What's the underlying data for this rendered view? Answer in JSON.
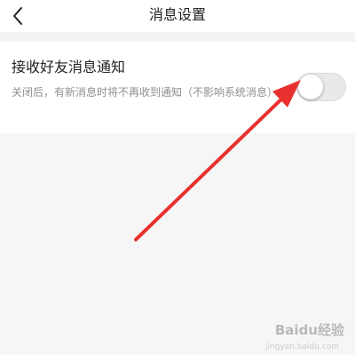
{
  "header": {
    "title": "消息设置",
    "back_icon": "chevron-left-icon"
  },
  "setting": {
    "title": "接收好友消息通知",
    "description": "关闭后，有新消息时将不再收到通知（不影响系统消息）",
    "enabled": false
  },
  "annotation": {
    "color": "#e8312f"
  },
  "watermark": {
    "brand": "Baidu经验",
    "url": "jingyan.baidu.com"
  }
}
